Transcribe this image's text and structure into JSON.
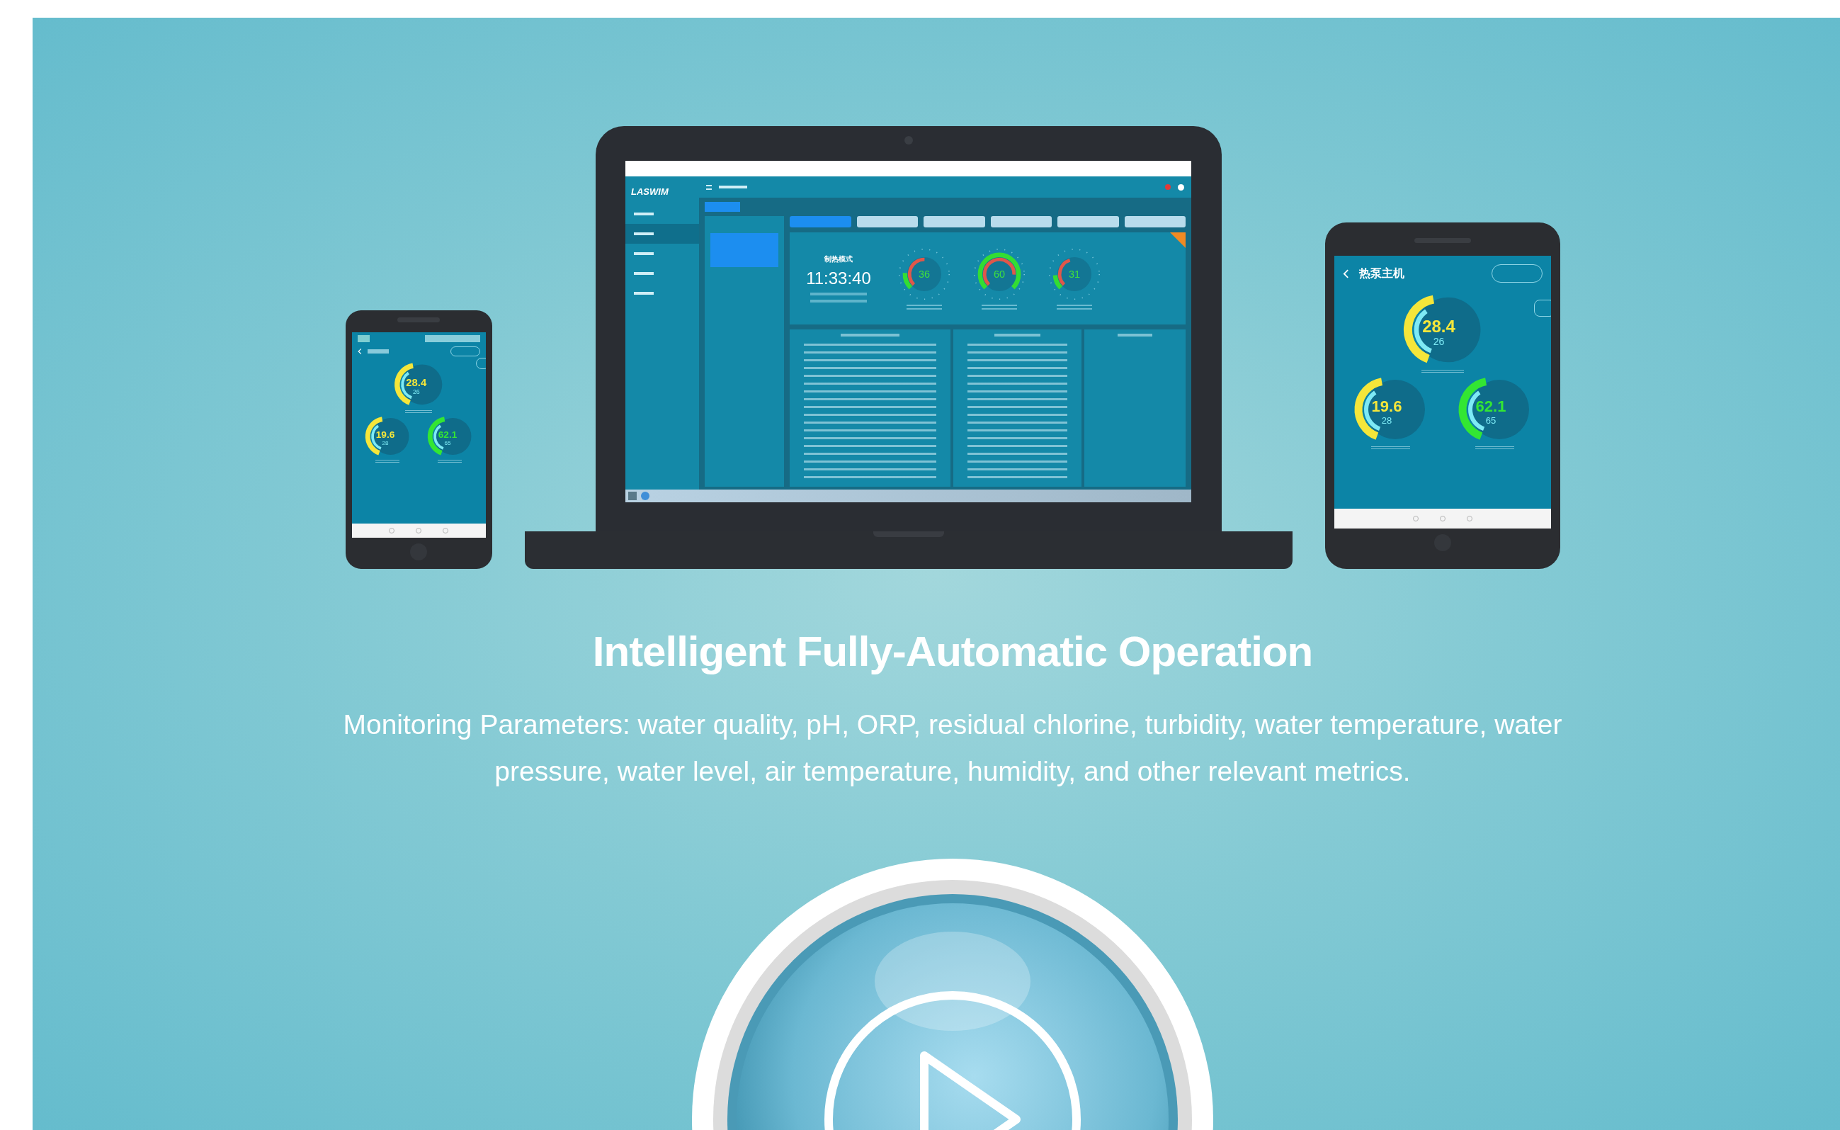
{
  "laptop": {
    "logo": "LASWIM",
    "nav_items": [
      {
        "selected": false
      },
      {
        "selected": true
      },
      {
        "selected": false
      },
      {
        "selected": false
      },
      {
        "selected": false
      }
    ],
    "tabs": [
      {
        "selected": true
      },
      {
        "selected": false
      },
      {
        "selected": false
      },
      {
        "selected": false
      },
      {
        "selected": false
      },
      {
        "selected": false
      }
    ],
    "mode": "制热模式",
    "time": "11:33:40",
    "gauges": [
      {
        "value": "36"
      },
      {
        "value": "60"
      },
      {
        "value": "31"
      }
    ]
  },
  "phone": {
    "gauges": [
      {
        "value": "28.4",
        "setpoint": "26",
        "color": "#f5e63a"
      },
      {
        "value": "19.6",
        "setpoint": "28",
        "color": "#f5e63a"
      },
      {
        "value": "62.1",
        "setpoint": "65",
        "color": "#33e633"
      }
    ]
  },
  "tablet": {
    "title": "热泵主机",
    "gauges": [
      {
        "value": "28.4",
        "setpoint": "26",
        "color": "#f5e63a"
      },
      {
        "value": "19.6",
        "setpoint": "28",
        "color": "#f5e63a"
      },
      {
        "value": "62.1",
        "setpoint": "65",
        "color": "#33e633"
      }
    ]
  },
  "heading": "Intelligent Fully-Automatic Operation",
  "description": "Monitoring Parameters: water quality, pH, ORP, residual chlorine, turbidity, water temperature, water pressure, water level, air temperature, humidity, and other relevant metrics."
}
